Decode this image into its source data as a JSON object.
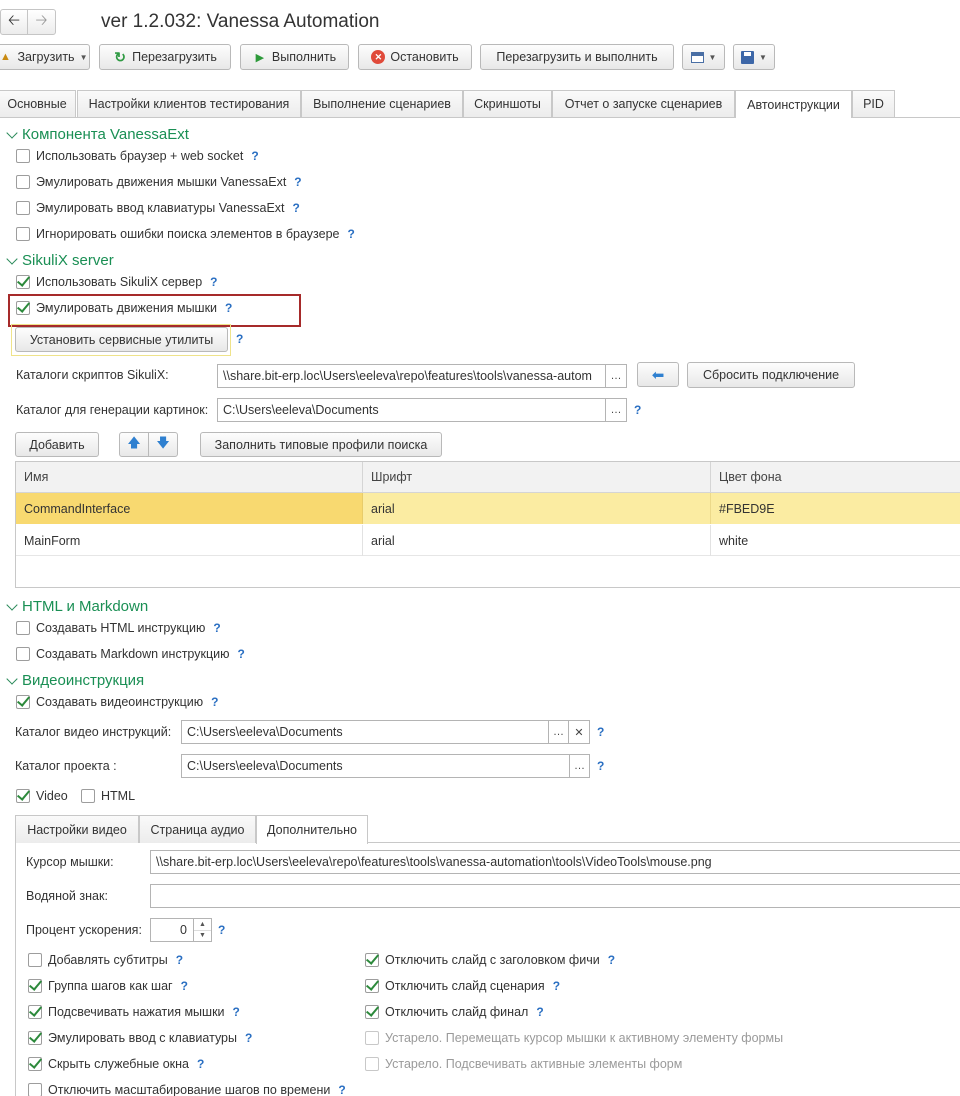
{
  "window": {
    "title": "ver 1.2.032: Vanessa Automation"
  },
  "nav": {
    "back_icon": "arrow-left-icon",
    "forward_icon": "arrow-right-icon"
  },
  "toolbar": {
    "load": "Загрузить",
    "reload": "Перезагрузить",
    "run": "Выполнить",
    "stop": "Остановить",
    "reload_run": "Перезагрузить и выполнить"
  },
  "tabs": [
    "Основные",
    "Настройки клиентов тестирования",
    "Выполнение сценариев",
    "Скриншоты",
    "Отчет о запуске сценариев",
    "Автоинструкции",
    "PID"
  ],
  "active_tab": "Автоинструкции",
  "section_vanessaext": {
    "title": "Компонента VanessaExt",
    "items": [
      {
        "label": "Использовать браузер + web socket",
        "checked": false
      },
      {
        "label": "Эмулировать движения мышки VanessaExt",
        "checked": false
      },
      {
        "label": "Эмулировать ввод клавиатуры VanessaExt",
        "checked": false
      },
      {
        "label": "Игнорировать ошибки поиска элементов в браузере",
        "checked": false
      }
    ]
  },
  "section_sikulix": {
    "title": "SikuliX server",
    "use_server": {
      "label": "Использовать SikuliX сервер",
      "checked": true
    },
    "emulate_mouse": {
      "label": "Эмулировать движения мышки",
      "checked": true
    },
    "install_utils": "Установить сервисные утилиты",
    "scripts_label": "Каталоги скриптов SikuliX:",
    "scripts_value": "\\\\share.bit-erp.loc\\Users\\eeleva\\repo\\features\\tools\\vanessa-autom",
    "reset_connection": "Сбросить подключение",
    "images_label": "Каталог для генерации картинок:",
    "images_value": "C:\\Users\\eeleva\\Documents",
    "add": "Добавить",
    "fill_profiles": "Заполнить типовые профили поиска"
  },
  "table": {
    "columns": [
      "Имя",
      "Шрифт",
      "Цвет фона"
    ],
    "rows": [
      {
        "name": "CommandInterface",
        "font": "arial",
        "bg": "#FBED9E",
        "selected": true
      },
      {
        "name": "MainForm",
        "font": "arial",
        "bg": "white",
        "selected": false
      }
    ]
  },
  "section_html": {
    "title": "HTML и Markdown",
    "items": [
      {
        "label": "Создавать HTML инструкцию",
        "checked": false
      },
      {
        "label": "Создавать Markdown инструкцию",
        "checked": false
      }
    ]
  },
  "section_video": {
    "title": "Видеоинструкция",
    "create": {
      "label": "Создавать видеоинструкцию",
      "checked": true
    },
    "video_dir_label": "Каталог видео инструкций:",
    "video_dir_value": "C:\\Users\\eeleva\\Documents",
    "project_dir_label": "Каталог проекта :",
    "project_dir_value": "C:\\Users\\eeleva\\Documents",
    "video_cb": {
      "label": "Video",
      "checked": true
    },
    "html_cb": {
      "label": "HTML",
      "checked": false
    }
  },
  "inner_tabs": [
    "Настройки видео",
    "Страница аудио",
    "Дополнительно"
  ],
  "inner_active": "Дополнительно",
  "extra": {
    "cursor_label": "Курсор мышки:",
    "cursor_value": "\\\\share.bit-erp.loc\\Users\\eeleva\\repo\\features\\tools\\vanessa-automation\\tools\\VideoTools\\mouse.png",
    "watermark_label": "Водяной знак:",
    "watermark_value": "",
    "speedup_label": "Процент ускорения:",
    "speedup_value": "0",
    "left_options": [
      {
        "label": "Добавлять субтитры",
        "checked": false
      },
      {
        "label": "Группа шагов как шаг",
        "checked": true
      },
      {
        "label": "Подсвечивать нажатия мышки",
        "checked": true
      },
      {
        "label": "Эмулировать ввод с клавиатуры",
        "checked": true
      },
      {
        "label": "Скрыть служебные окна",
        "checked": true
      },
      {
        "label": "Отключить масштабирование шагов по времени",
        "checked": false
      }
    ],
    "right_options": [
      {
        "label": "Отключить слайд с заголовком фичи",
        "checked": true,
        "disabled": false
      },
      {
        "label": "Отключить слайд сценария",
        "checked": true,
        "disabled": false
      },
      {
        "label": "Отключить слайд финал",
        "checked": true,
        "disabled": false
      },
      {
        "label": "Устарело. Перемещать курсор мышки к активному элементу формы",
        "checked": false,
        "disabled": true
      },
      {
        "label": "Устарело. Подсвечивать активные элементы форм",
        "checked": false,
        "disabled": true
      }
    ]
  },
  "colors": {
    "accent_green": "#1a8f54",
    "highlight_frame": "#a62a2a",
    "selected_row": "#fbeca2",
    "help": "#2a6fc2"
  }
}
